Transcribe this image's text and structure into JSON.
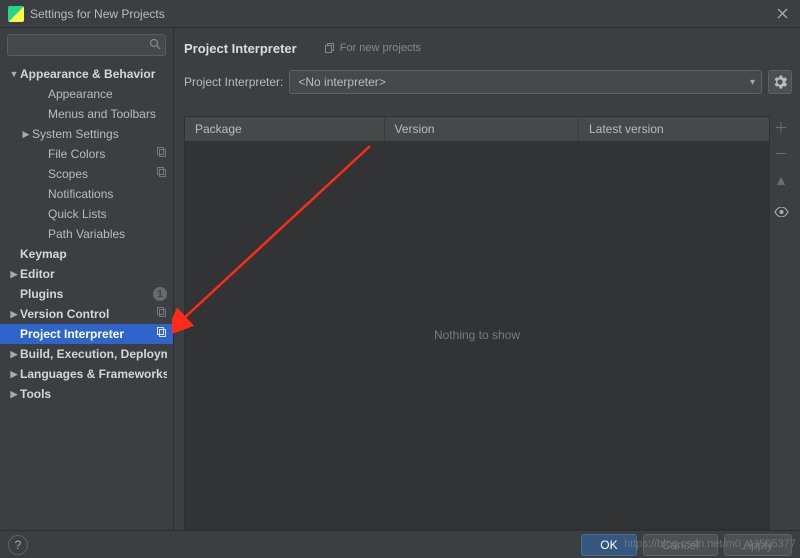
{
  "window": {
    "title": "Settings for New Projects"
  },
  "sidebar": {
    "search_placeholder": "",
    "items": [
      {
        "label": "Appearance & Behavior",
        "depth": 0,
        "bold": true,
        "arrow": "▼"
      },
      {
        "label": "Appearance",
        "depth": 2
      },
      {
        "label": "Menus and Toolbars",
        "depth": 2
      },
      {
        "label": "System Settings",
        "depth": 1,
        "arrow": "▶"
      },
      {
        "label": "File Colors",
        "depth": 2,
        "trail": "pin"
      },
      {
        "label": "Scopes",
        "depth": 2,
        "trail": "pin"
      },
      {
        "label": "Notifications",
        "depth": 2
      },
      {
        "label": "Quick Lists",
        "depth": 2
      },
      {
        "label": "Path Variables",
        "depth": 2
      },
      {
        "label": "Keymap",
        "depth": 0,
        "bold": true
      },
      {
        "label": "Editor",
        "depth": 0,
        "bold": true,
        "arrow": "▶"
      },
      {
        "label": "Plugins",
        "depth": 0,
        "bold": true,
        "trail": "badge",
        "badge": "1"
      },
      {
        "label": "Version Control",
        "depth": 0,
        "bold": true,
        "arrow": "▶",
        "trail": "pin"
      },
      {
        "label": "Project Interpreter",
        "depth": 0,
        "bold": true,
        "selected": true,
        "trail": "pin"
      },
      {
        "label": "Build, Execution, Deployment",
        "depth": 0,
        "bold": true,
        "arrow": "▶"
      },
      {
        "label": "Languages & Frameworks",
        "depth": 0,
        "bold": true,
        "arrow": "▶"
      },
      {
        "label": "Tools",
        "depth": 0,
        "bold": true,
        "arrow": "▶"
      }
    ]
  },
  "content": {
    "title": "Project Interpreter",
    "for_new": "For new projects",
    "interpreter_label": "Project Interpreter:",
    "interpreter_value": "<No interpreter>",
    "columns": [
      "Package",
      "Version",
      "Latest version"
    ],
    "empty_text": "Nothing to show"
  },
  "buttons": {
    "ok": "OK",
    "cancel": "Cancel",
    "apply": "Apply"
  },
  "watermark": "https://blog.csdn.net/m0_43505377"
}
